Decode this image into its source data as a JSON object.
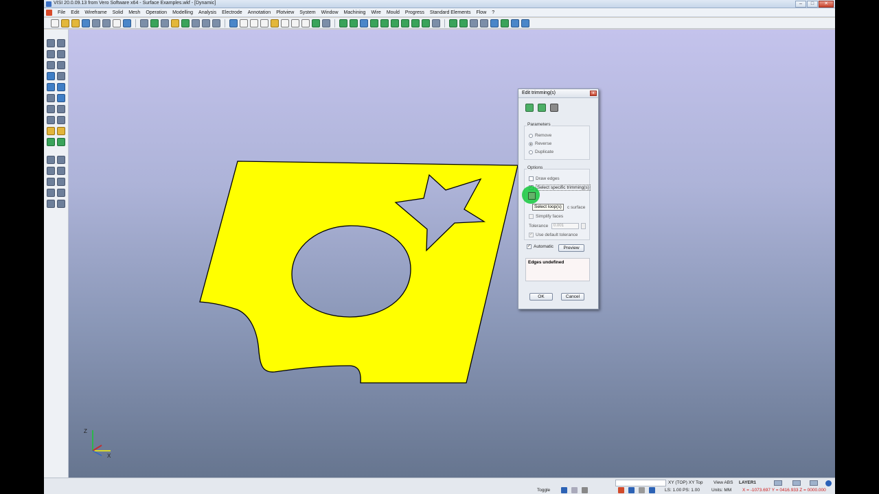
{
  "window": {
    "title": "VISI 20.0.09.13 from Vero Software x64 - Surface Examples.wkf - [Dynamic]",
    "buttons": {
      "minimize": "–",
      "maximize": "□",
      "close": "✕"
    }
  },
  "menu": [
    "File",
    "Edit",
    "Wireframe",
    "Solid",
    "Mesh",
    "Operation",
    "Modelling",
    "Analysis",
    "Electrode",
    "Annotation",
    "Plotview",
    "System",
    "Window",
    "Machining",
    "Wire",
    "Mould",
    "Progress",
    "Standard Elements",
    "Flow",
    "?"
  ],
  "dialog": {
    "title": "Edit trimming(s)",
    "close": "x",
    "parameters": {
      "title": "Parameters",
      "options": [
        "Remove",
        "Reverse",
        "Duplicate"
      ],
      "selected": "Reverse"
    },
    "options": {
      "title": "Options",
      "draw_edges": "Draw edges",
      "select_specific": "Select specific trimming(s)",
      "surface_suffix": "c surface",
      "simplify": "Simplify faces",
      "tolerance_label": "Tolerance",
      "tolerance_value": "0.001",
      "use_default": "Use default tolerance"
    },
    "automatic": "Automatic",
    "preview": "Preview",
    "status": "Edges undefined",
    "ok": "OK",
    "cancel": "Cancel",
    "tooltip": "Select loop(s)",
    "colors": {
      "surface": "#ffff00",
      "cursor_highlight": "#14c83c"
    }
  },
  "status": {
    "search_value": "",
    "view": "XY (TOP) XY Top",
    "view_abs": "View ABS",
    "layer": "LAYER1",
    "toggle": "Toggle",
    "ls_ps": "LS: 1.00 PS: 1.00",
    "units": "Units: MM",
    "coords": "X = -1073.697  Y = 0416.933  Z = 0000.000"
  },
  "axis": {
    "z": "Z",
    "x": "X"
  }
}
